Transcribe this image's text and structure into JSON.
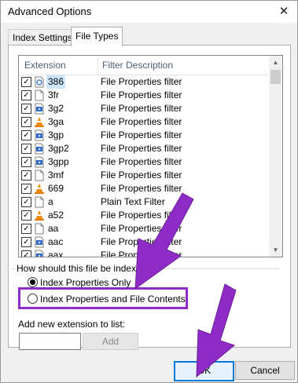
{
  "window": {
    "title": "Advanced Options",
    "close_glyph": "✕"
  },
  "tabs": [
    {
      "label": "Index Settings",
      "active": false
    },
    {
      "label": "File Types",
      "active": true
    }
  ],
  "listview": {
    "columns": [
      "Extension",
      "Filter Description"
    ],
    "rows": [
      {
        "ext": "386",
        "desc": "File Properties filter",
        "checked": true,
        "icon": "properties-doc-icon",
        "selected": true
      },
      {
        "ext": "3fr",
        "desc": "File Properties filter",
        "checked": true,
        "icon": "blank-doc-icon"
      },
      {
        "ext": "3g2",
        "desc": "File Properties filter",
        "checked": true,
        "icon": "media-file-icon"
      },
      {
        "ext": "3ga",
        "desc": "File Properties filter",
        "checked": true,
        "icon": "vlc-cone-icon"
      },
      {
        "ext": "3gp",
        "desc": "File Properties filter",
        "checked": true,
        "icon": "media-file-icon"
      },
      {
        "ext": "3gp2",
        "desc": "File Properties filter",
        "checked": true,
        "icon": "media-file-icon"
      },
      {
        "ext": "3gpp",
        "desc": "File Properties filter",
        "checked": true,
        "icon": "media-file-icon"
      },
      {
        "ext": "3mf",
        "desc": "File Properties filter",
        "checked": true,
        "icon": "blank-doc-icon"
      },
      {
        "ext": "669",
        "desc": "File Properties filter",
        "checked": true,
        "icon": "vlc-cone-icon"
      },
      {
        "ext": "a",
        "desc": "Plain Text Filter",
        "checked": true,
        "icon": "blank-doc-icon"
      },
      {
        "ext": "a52",
        "desc": "File Properties filter",
        "checked": true,
        "icon": "vlc-cone-icon"
      },
      {
        "ext": "aa",
        "desc": "File Properties filter",
        "checked": true,
        "icon": "blank-doc-icon"
      },
      {
        "ext": "aac",
        "desc": "File Properties filter",
        "checked": true,
        "icon": "media-file-icon"
      },
      {
        "ext": "aax",
        "desc": "File Properties filter",
        "checked": true,
        "icon": "media-file-icon"
      }
    ]
  },
  "index_group": {
    "label": "How should this file be indexed?",
    "options": [
      {
        "label": "Index Properties Only",
        "selected": true
      },
      {
        "label": "Index Properties and File Contents",
        "selected": false
      }
    ]
  },
  "add_extension": {
    "label": "Add new extension to list:",
    "value": "",
    "button": "Add"
  },
  "footer": {
    "ok": "OK",
    "cancel": "Cancel"
  },
  "colors": {
    "annotation": "#8e2bc6",
    "selection": "#cce8ff",
    "ok_border": "#0078d7"
  }
}
